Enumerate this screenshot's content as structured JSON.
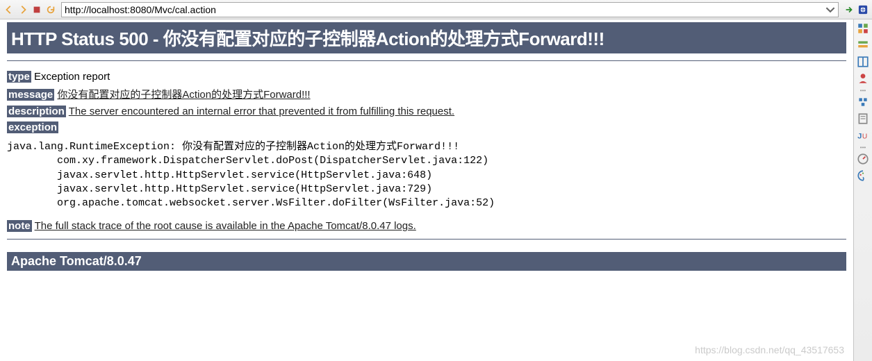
{
  "toolbar": {
    "url": "http://localhost:8080/Mvc/cal.action"
  },
  "page": {
    "status_title": "HTTP Status 500 - 你没有配置对应的子控制器Action的处理方式Forward!!!",
    "type_label": "type",
    "type_value": " Exception report",
    "message_label": "message",
    "message_value": "你没有配置对应的子控制器Action的处理方式Forward!!!",
    "description_label": "description",
    "description_value": "The server encountered an internal error that prevented it from fulfilling this request.",
    "exception_label": "exception",
    "stack": "java.lang.RuntimeException: 你没有配置对应的子控制器Action的处理方式Forward!!!\n\tcom.xy.framework.DispatcherServlet.doPost(DispatcherServlet.java:122)\n\tjavax.servlet.http.HttpServlet.service(HttpServlet.java:648)\n\tjavax.servlet.http.HttpServlet.service(HttpServlet.java:729)\n\torg.apache.tomcat.websocket.server.WsFilter.doFilter(WsFilter.java:52)",
    "note_label": "note",
    "note_value": "The full stack trace of the root cause is available in the Apache Tomcat/8.0.47 logs.",
    "footer": "Apache Tomcat/8.0.47"
  },
  "watermark": "https://blog.csdn.net/qq_43517653"
}
